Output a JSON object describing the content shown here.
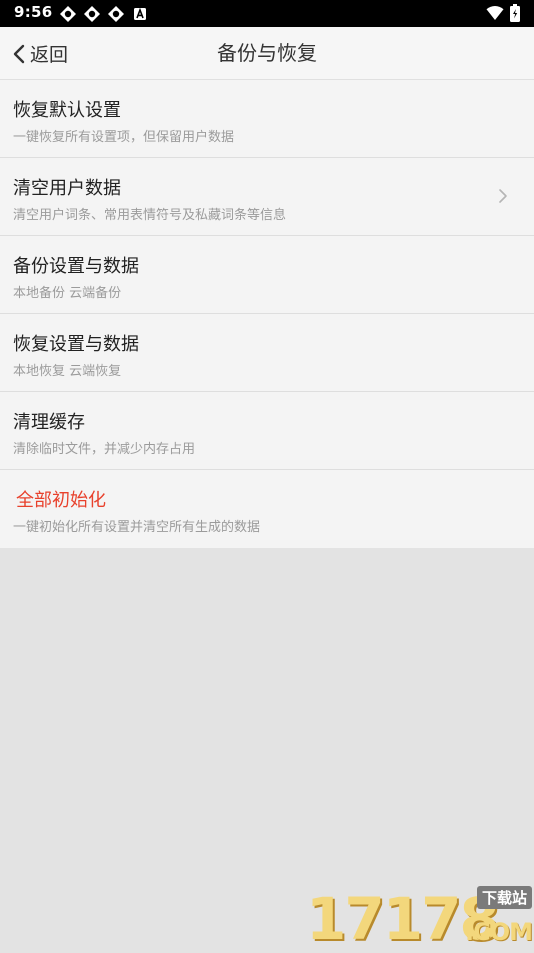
{
  "status_bar": {
    "time": "9:56",
    "left_icons": [
      "notification-icon",
      "notification-icon",
      "notification-icon",
      "text-a-icon"
    ],
    "right_icons": [
      "wifi-icon",
      "battery-icon"
    ]
  },
  "header": {
    "back_label": "返回",
    "title": "备份与恢复"
  },
  "settings": {
    "items": [
      {
        "title": "恢复默认设置",
        "subtitle": "一键恢复所有设置项，但保留用户数据"
      },
      {
        "title": "清空用户数据",
        "subtitle": "清空用户词条、常用表情符号及私藏词条等信息",
        "has_chevron": true
      },
      {
        "title": "备份设置与数据",
        "subtitle": "本地备份 云端备份"
      },
      {
        "title": "恢复设置与数据",
        "subtitle": "本地恢复 云端恢复"
      },
      {
        "title": "清理缓存",
        "subtitle": "清除临时文件，并减少内存占用"
      },
      {
        "title": "全部初始化",
        "subtitle": "一键初始化所有设置并清空所有生成的数据",
        "title_color": "#e8412c"
      }
    ]
  },
  "watermark": {
    "digits": "17178",
    "badge": "下载站",
    "suffix": ".COM"
  },
  "colors": {
    "danger": "#e8412c",
    "background": "#e3e3e3",
    "list_background": "#f4f4f4"
  }
}
